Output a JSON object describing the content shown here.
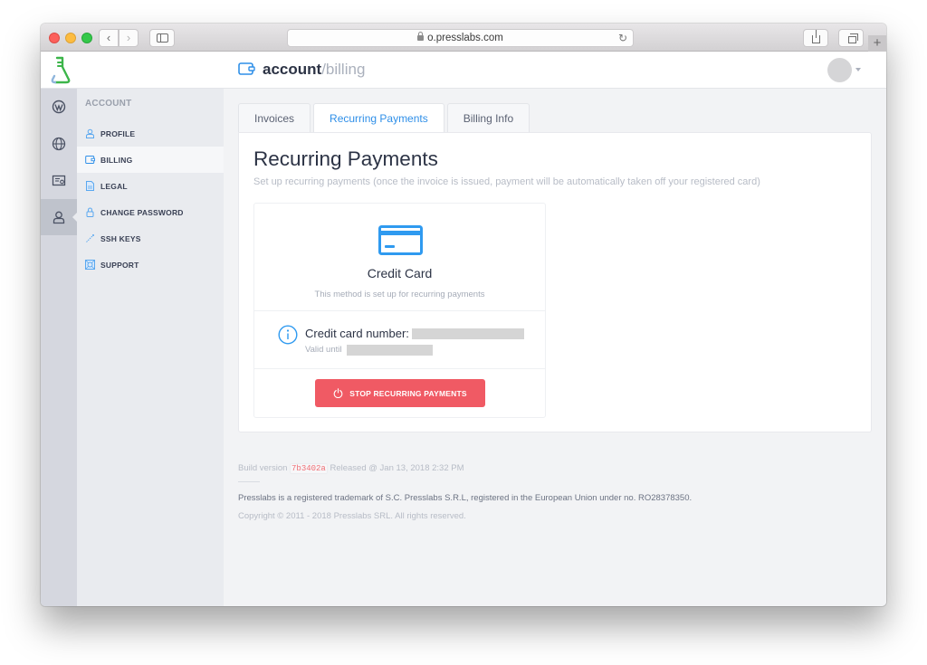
{
  "browser": {
    "url": "o.presslabs.com",
    "back_label": "‹",
    "forward_label": "›",
    "reload_label": "↻",
    "new_tab_label": "+"
  },
  "header": {
    "breadcrumb_main": "account",
    "breadcrumb_sep": "/",
    "breadcrumb_sub": "billing",
    "logo_color": "#3cb54a",
    "accent_color": "#2f8fe8"
  },
  "rail": {
    "items": [
      {
        "name": "wordpress",
        "active": false
      },
      {
        "name": "globe",
        "active": false
      },
      {
        "name": "certificate",
        "active": false
      },
      {
        "name": "account",
        "active": true
      }
    ]
  },
  "subnav": {
    "title": "ACCOUNT",
    "items": [
      {
        "label": "PROFILE",
        "icon": "user-icon",
        "active": false
      },
      {
        "label": "BILLING",
        "icon": "wallet-icon",
        "active": true
      },
      {
        "label": "LEGAL",
        "icon": "document-icon",
        "active": false
      },
      {
        "label": "CHANGE PASSWORD",
        "icon": "lock-icon",
        "active": false
      },
      {
        "label": "SSH KEYS",
        "icon": "key-icon",
        "active": false
      },
      {
        "label": "SUPPORT",
        "icon": "lifebuoy-icon",
        "active": false
      }
    ]
  },
  "tabs": [
    {
      "label": "Invoices",
      "active": false
    },
    {
      "label": "Recurring Payments",
      "active": true
    },
    {
      "label": "Billing Info",
      "active": false
    }
  ],
  "panel": {
    "title": "Recurring Payments",
    "subtitle": "Set up recurring payments (once the invoice is issued, payment will be automatically taken off your registered card)",
    "card": {
      "name": "Credit Card",
      "description": "This method is set up for recurring payments",
      "number_label": "Credit card number:",
      "valid_label": "Valid until",
      "stop_button": "STOP RECURRING PAYMENTS",
      "stop_color": "#f05a64"
    }
  },
  "footer": {
    "build_prefix": "Build version",
    "build_hash": "7b3402a",
    "build_suffix": "Released @ Jan 13, 2018 2:32 PM",
    "trademark": "Presslabs is a registered trademark of S.C. Presslabs S.R.L, registered in the European Union under no. RO28378350.",
    "copyright": "Copyright © 2011 - 2018 Presslabs SRL. All rights reserved."
  }
}
